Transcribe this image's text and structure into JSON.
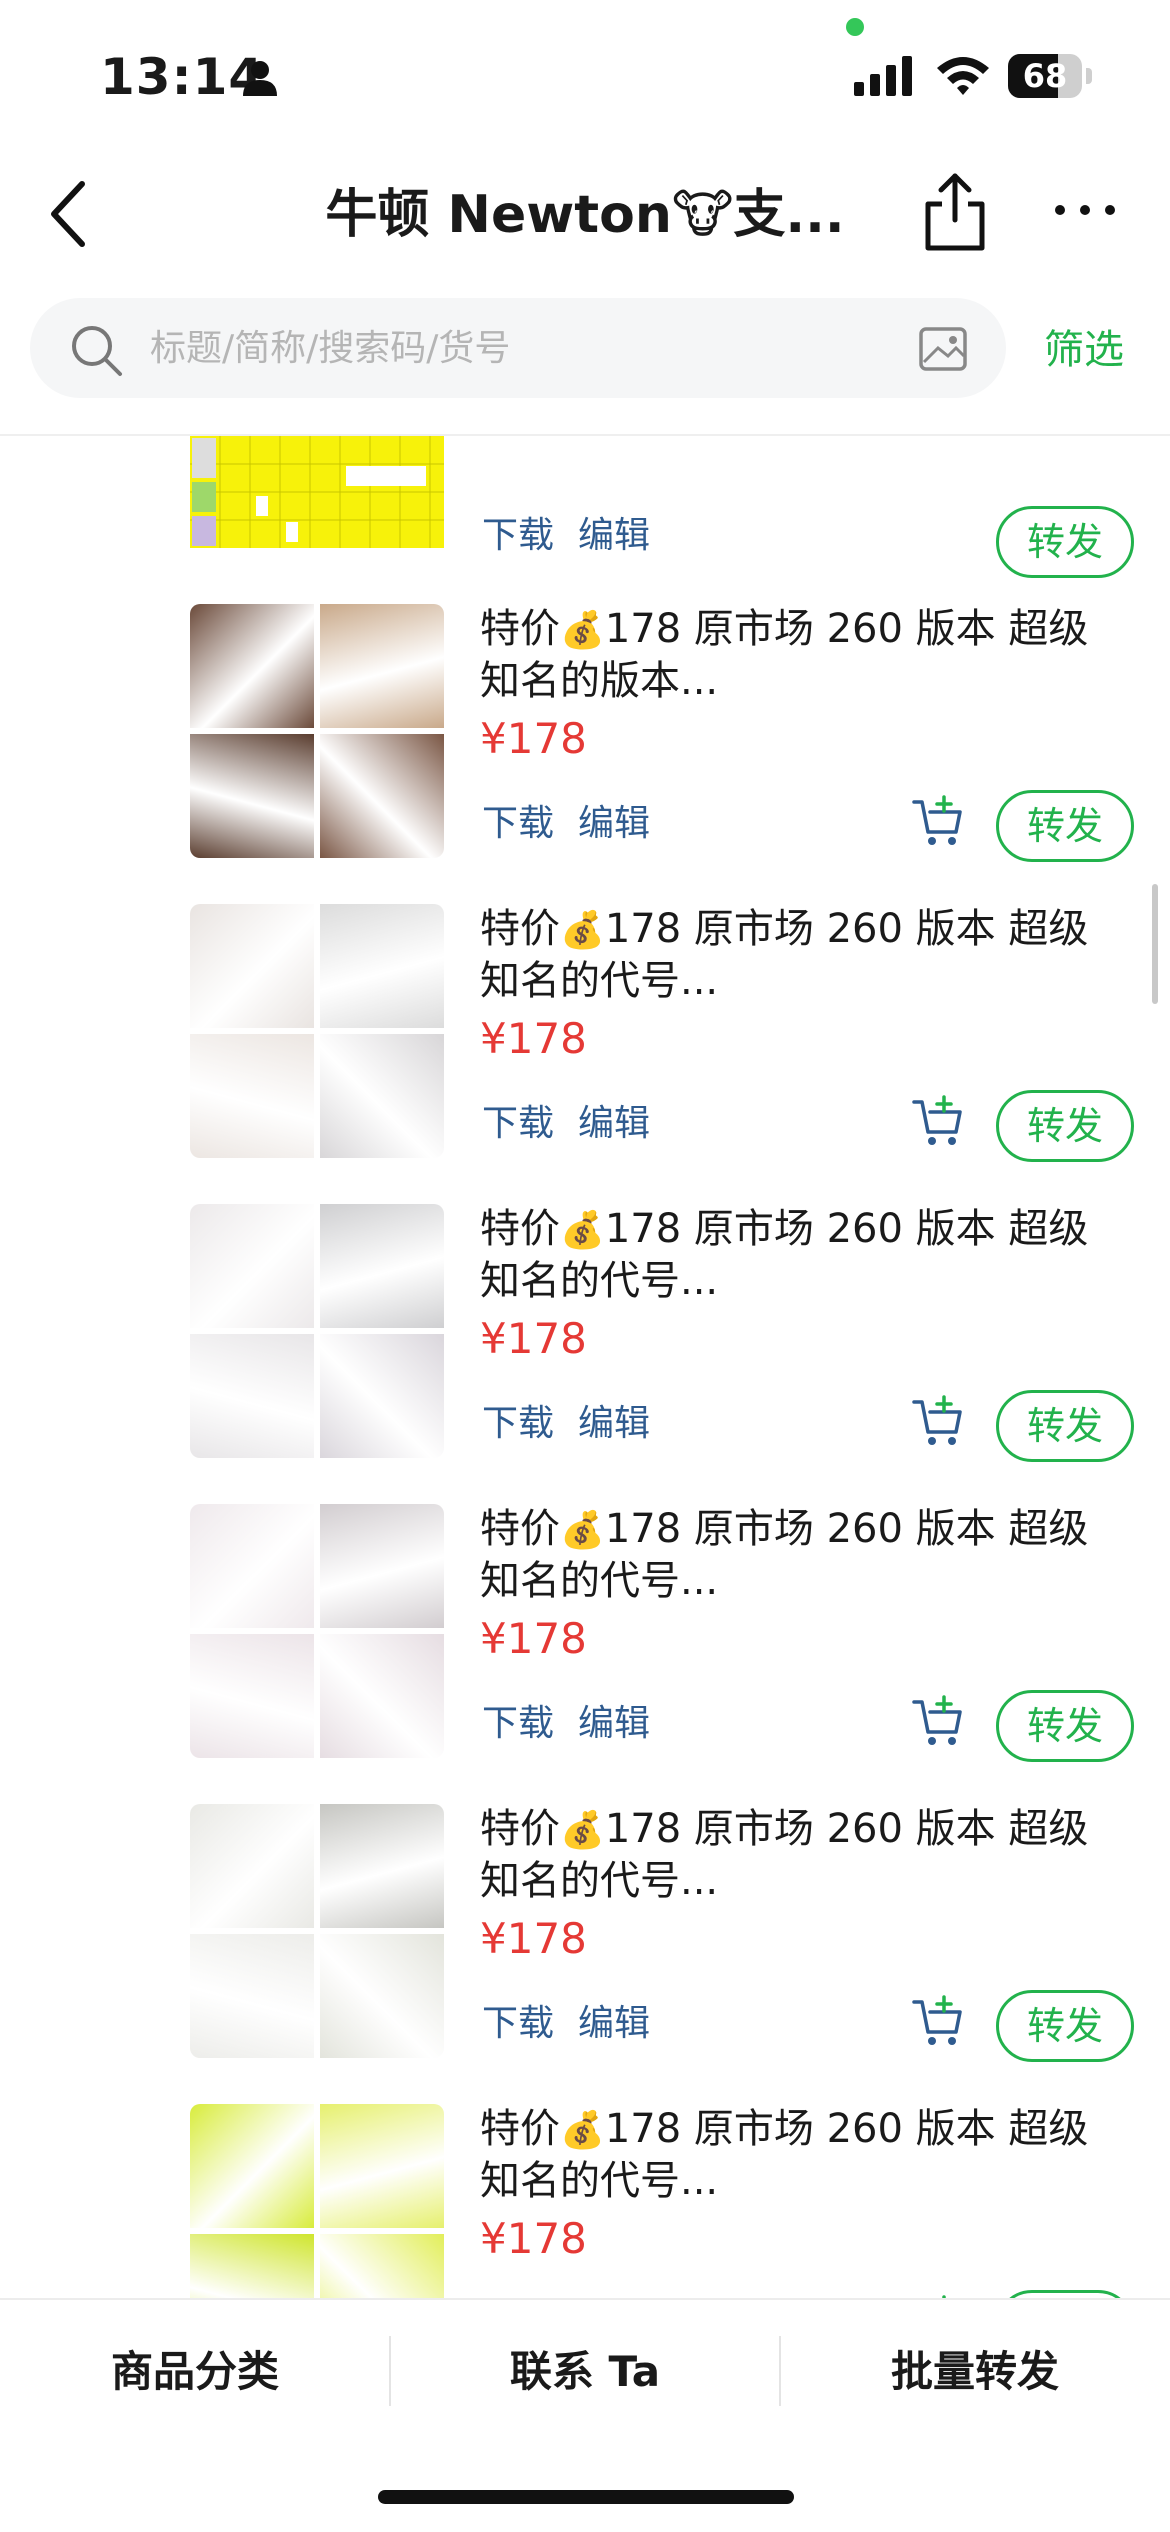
{
  "status_bar": {
    "time": "13:14",
    "battery": "68",
    "battery_level": 0.68
  },
  "nav": {
    "title": "牛顿 Newton🐮支..."
  },
  "search": {
    "placeholder": "标题/简称/搜索码/货号",
    "filter_label": "筛选"
  },
  "actions": {
    "download": "下载",
    "edit": "编辑",
    "forward": "转发"
  },
  "products": [
    {
      "title_prefix": "特价",
      "money_emoji": "💰",
      "title_rest": "178 原市场 260 版本 超级知名的版本...",
      "price": "¥178",
      "colors": [
        "#6b4a3a",
        "#c9a98a",
        "#5a3d2f",
        "#7a5644"
      ]
    },
    {
      "title_prefix": "特价",
      "money_emoji": "💰",
      "title_rest": "178 原市场 260 版本 超级知名的代号...",
      "price": "¥178",
      "colors": [
        "#e9e4e1",
        "#dcdcdc",
        "#ece6e2",
        "#d8d6d8"
      ]
    },
    {
      "title_prefix": "特价",
      "money_emoji": "💰",
      "title_rest": "178 原市场 260 版本 超级知名的代号...",
      "price": "¥178",
      "colors": [
        "#ece9ea",
        "#cfcfd1",
        "#e8e6e8",
        "#dad6dc"
      ]
    },
    {
      "title_prefix": "特价",
      "money_emoji": "💰",
      "title_rest": "178 原市场 260 版本 超级知名的代号...",
      "price": "¥178",
      "colors": [
        "#efe9ec",
        "#d2cdd0",
        "#ece4e8",
        "#e6dde2"
      ]
    },
    {
      "title_prefix": "特价",
      "money_emoji": "💰",
      "title_rest": "178 原市场 260 版本 超级知名的代号...",
      "price": "¥178",
      "colors": [
        "#e9e9e5",
        "#c6c6c2",
        "#ededea",
        "#e3e4dc"
      ]
    },
    {
      "title_prefix": "特价",
      "money_emoji": "💰",
      "title_rest": "178 原市场 260 版本 超级知名的代号...",
      "price": "¥178",
      "colors": [
        "#d8ec3c",
        "#e6f06e",
        "#cfe52e",
        "#e2ee5a"
      ]
    }
  ],
  "bottom_tabs": [
    "商品分类",
    "联系 Ta",
    "批量转发"
  ],
  "colors": {
    "accent": "#22b24c",
    "price": "#e53935",
    "link": "#2f5b8f"
  }
}
